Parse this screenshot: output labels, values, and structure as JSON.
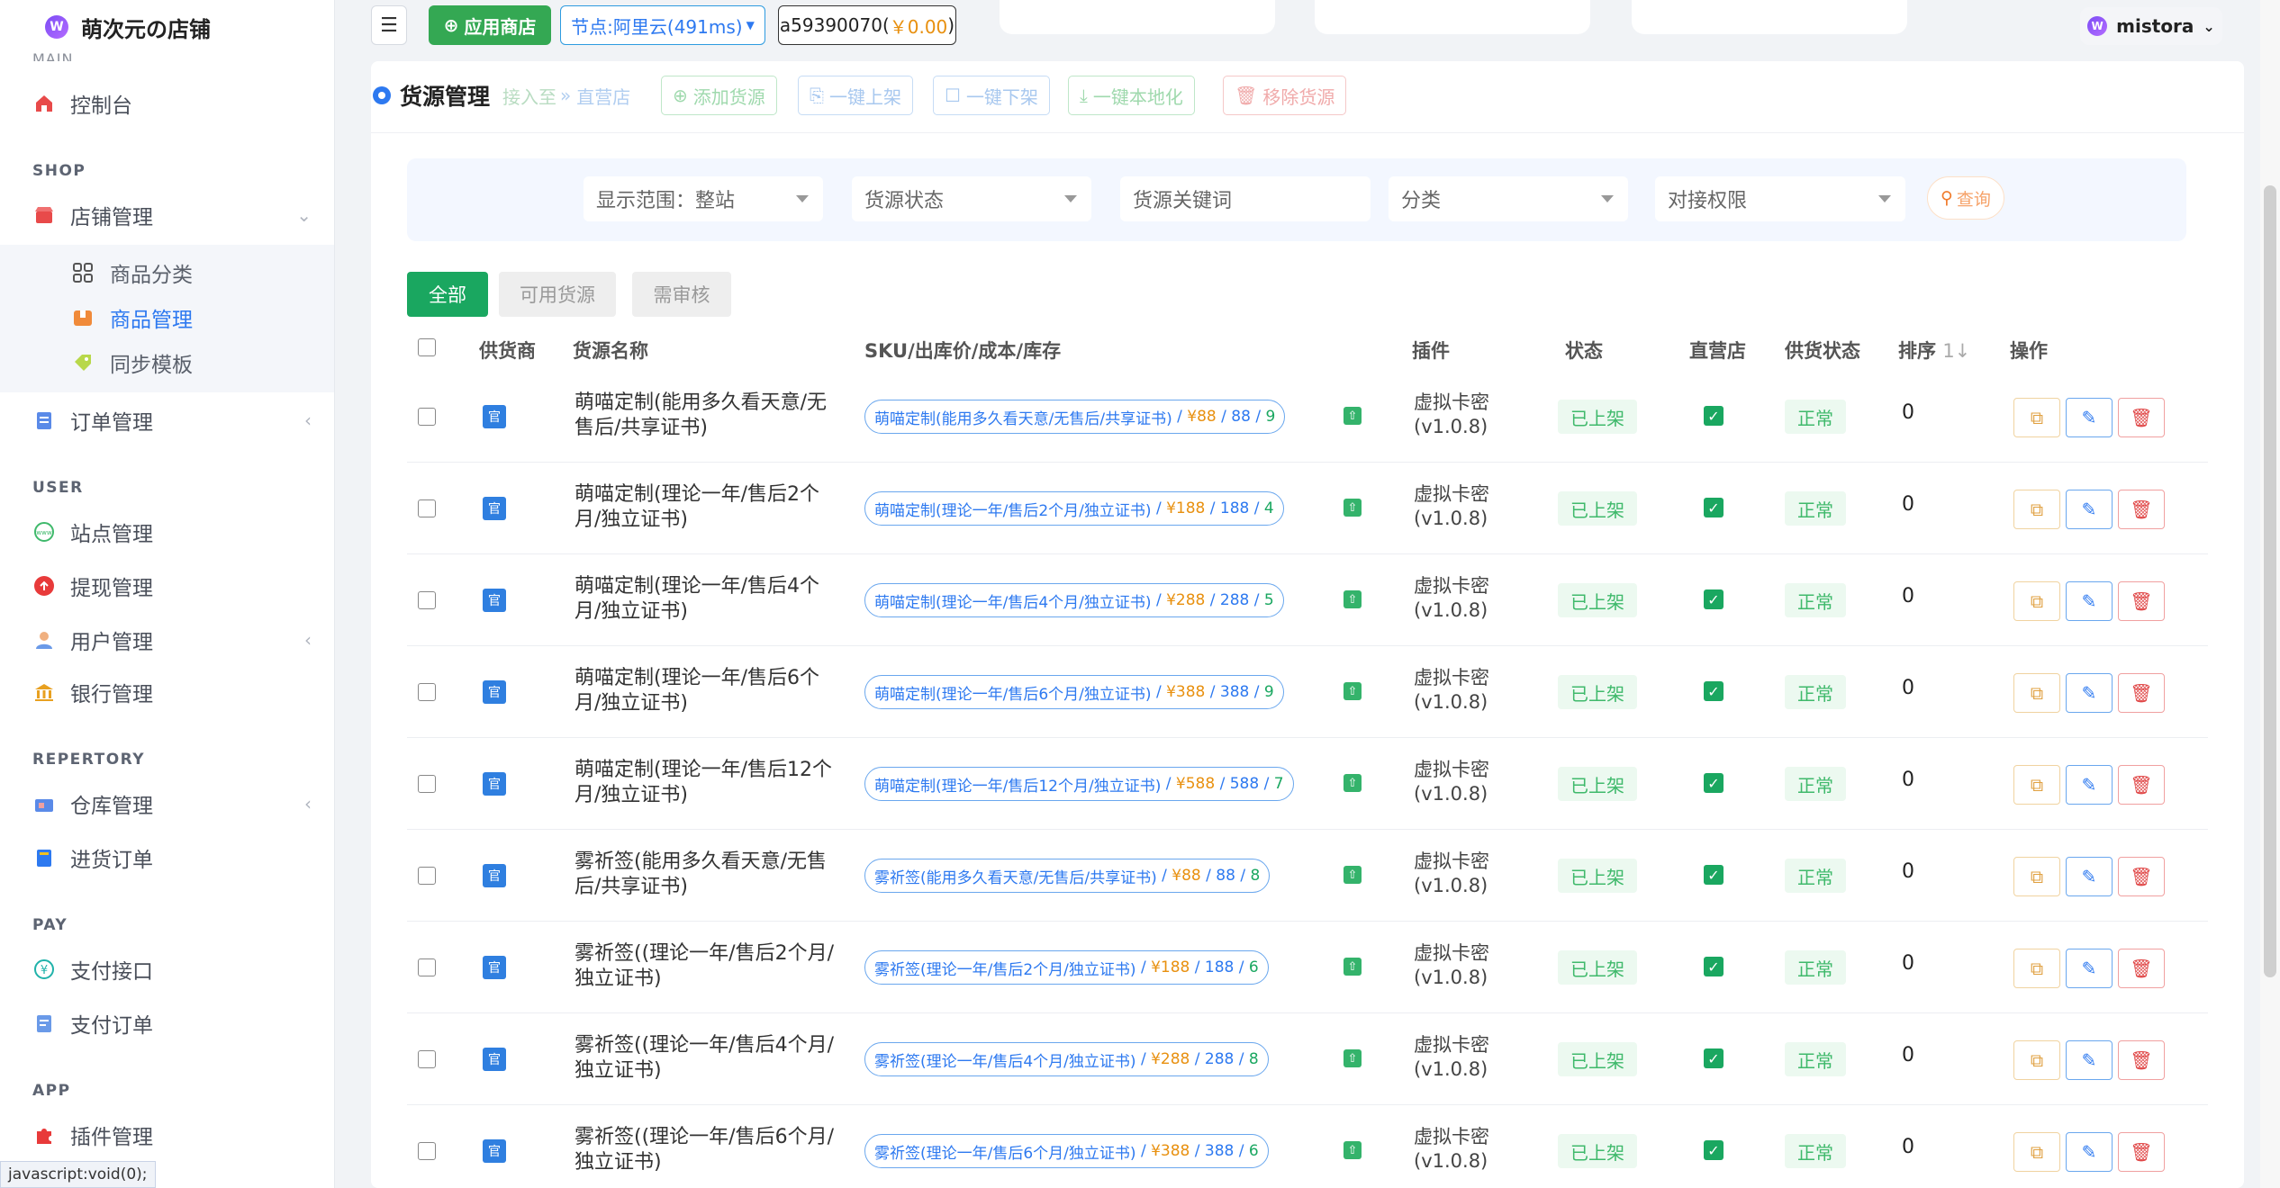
{
  "brand": {
    "title": "萌次元の店铺",
    "logo_letter": "W"
  },
  "sidebar": {
    "cut_label": "MAIN",
    "sections": {
      "shop": "SHOP",
      "user": "USER",
      "repertory": "REPERTORY",
      "pay": "PAY",
      "app": "APP"
    },
    "items": {
      "dashboard": "控制台",
      "store": "店铺管理",
      "category": "商品分类",
      "goods": "商品管理",
      "template": "同步模板",
      "orders": "订单管理",
      "sites": "站点管理",
      "withdraw": "提现管理",
      "users": "用户管理",
      "bank": "银行管理",
      "warehouse": "仓库管理",
      "purchase": "进货订单",
      "payapi": "支付接口",
      "payorder": "支付订单",
      "plugins": "插件管理"
    }
  },
  "topbar": {
    "menu_icon": "☰",
    "store_label": "应用商店",
    "node_label": "节点:阿里云(491ms)",
    "account_id": "a59390070(",
    "account_money": "￥0.00",
    "account_close": ")",
    "username": "mistora"
  },
  "header": {
    "title": "货源管理",
    "buttons": {
      "import": "接入至",
      "direct": "直营店",
      "add": "添加货源",
      "onshelf": "一键上架",
      "offshelf": "一键下架",
      "localize": "一键本地化",
      "remove": "移除货源"
    }
  },
  "filter": {
    "scope": "显示范围：整站",
    "status": "货源状态",
    "keyword": "货源关键词",
    "category": "分类",
    "permission": "对接权限",
    "query": "查询"
  },
  "tabs": [
    "全部",
    "可用货源",
    "需审核"
  ],
  "columns": [
    "供货商",
    "货源名称",
    "SKU/出库价/成本/库存",
    "插件",
    "状态",
    "直营店",
    "供货状态",
    "排序",
    "操作"
  ],
  "sort_icon": "1↓",
  "rows": [
    {
      "name": "萌喵定制(能用多久看天意/无售后/共享证书)",
      "sku_name": "萌喵定制(能用多久看天意/无售后/共享证书)",
      "price": "¥88",
      "cost": "88",
      "stock": "9",
      "plugin": "虚拟卡密(v1.0.8)",
      "status": "已上架",
      "supply": "正常",
      "sort": "0"
    },
    {
      "name": "萌喵定制(理论一年/售后2个月/独立证书)",
      "sku_name": "萌喵定制(理论一年/售后2个月/独立证书)",
      "price": "¥188",
      "cost": "188",
      "stock": "4",
      "plugin": "虚拟卡密(v1.0.8)",
      "status": "已上架",
      "supply": "正常",
      "sort": "0"
    },
    {
      "name": "萌喵定制(理论一年/售后4个月/独立证书)",
      "sku_name": "萌喵定制(理论一年/售后4个月/独立证书)",
      "price": "¥288",
      "cost": "288",
      "stock": "5",
      "plugin": "虚拟卡密(v1.0.8)",
      "status": "已上架",
      "supply": "正常",
      "sort": "0"
    },
    {
      "name": "萌喵定制(理论一年/售后6个月/独立证书)",
      "sku_name": "萌喵定制(理论一年/售后6个月/独立证书)",
      "price": "¥388",
      "cost": "388",
      "stock": "9",
      "plugin": "虚拟卡密(v1.0.8)",
      "status": "已上架",
      "supply": "正常",
      "sort": "0"
    },
    {
      "name": "萌喵定制(理论一年/售后12个月/独立证书)",
      "sku_name": "萌喵定制(理论一年/售后12个月/独立证书)",
      "price": "¥588",
      "cost": "588",
      "stock": "7",
      "plugin": "虚拟卡密(v1.0.8)",
      "status": "已上架",
      "supply": "正常",
      "sort": "0"
    },
    {
      "name": "雾祈签(能用多久看天意/无售后/共享证书)",
      "sku_name": "雾祈签(能用多久看天意/无售后/共享证书)",
      "price": "¥88",
      "cost": "88",
      "stock": "8",
      "plugin": "虚拟卡密(v1.0.8)",
      "status": "已上架",
      "supply": "正常",
      "sort": "0"
    },
    {
      "name": "雾祈签((理论一年/售后2个月/独立证书)",
      "sku_name": "雾祈签(理论一年/售后2个月/独立证书)",
      "price": "¥188",
      "cost": "188",
      "stock": "6",
      "plugin": "虚拟卡密(v1.0.8)",
      "status": "已上架",
      "supply": "正常",
      "sort": "0"
    },
    {
      "name": "雾祈签((理论一年/售后4个月/独立证书)",
      "sku_name": "雾祈签(理论一年/售后4个月/独立证书)",
      "price": "¥288",
      "cost": "288",
      "stock": "8",
      "plugin": "虚拟卡密(v1.0.8)",
      "status": "已上架",
      "supply": "正常",
      "sort": "0"
    },
    {
      "name": "雾祈签((理论一年/售后6个月/独立证书)",
      "sku_name": "雾祈签(理论一年/售后6个月/独立证书)",
      "price": "¥388",
      "cost": "388",
      "stock": "6",
      "plugin": "虚拟卡密(v1.0.8)",
      "status": "已上架",
      "supply": "正常",
      "sort": "0"
    }
  ],
  "statusbar": "javascript:void(0);"
}
